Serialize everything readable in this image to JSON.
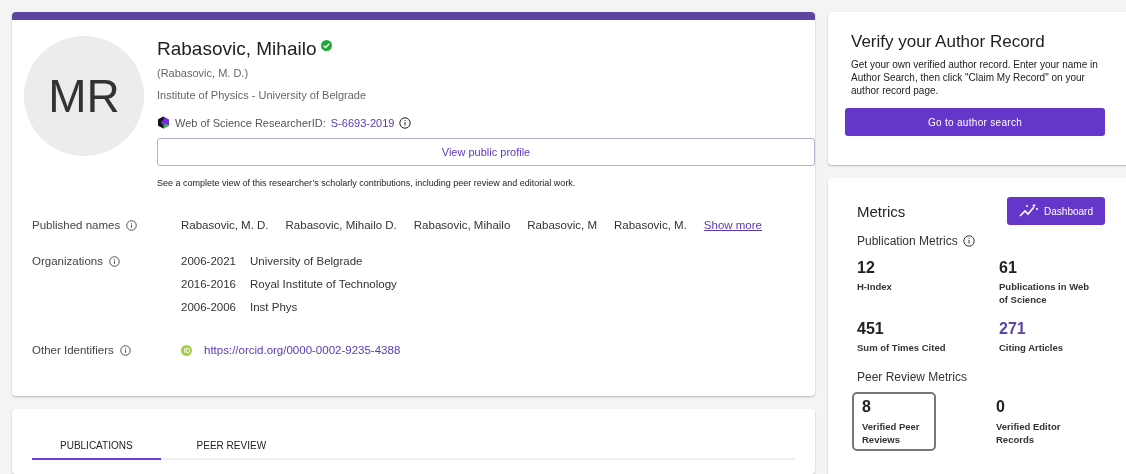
{
  "profile": {
    "initials": "MR",
    "name": "Rabasovic, Mihailo",
    "verified": true,
    "short_name": "(Rabasovic, M. D.)",
    "institution": "Institute of Physics - University of Belgrade",
    "researcher_id_label": "Web of Science ResearcherID:",
    "researcher_id": "S-6693-2019",
    "view_button": "View public profile",
    "view_note": "See a complete view of this researcher’s scholarly contributions, including peer review and editorial work."
  },
  "published_names": {
    "label": "Published names",
    "names": [
      "Rabasovic, M. D.",
      "Rabasovic, Mihailo D.",
      "Rabasovic, Mihailo",
      "Rabasovic, M",
      "Rabasovic, M."
    ],
    "more": "Show more"
  },
  "organizations": {
    "label": "Organizations",
    "items": [
      {
        "years": "2006-2021",
        "name": "University of Belgrade"
      },
      {
        "years": "2016-2016",
        "name": "Royal Institute of Technology"
      },
      {
        "years": "2006-2006",
        "name": "Inst Phys"
      }
    ]
  },
  "other_identifiers": {
    "label": "Other Identifiers",
    "orcid": "https://orcid.org/0000-0002-9235-4388"
  },
  "tabs": [
    {
      "label": "PUBLICATIONS",
      "selected": true
    },
    {
      "label": "PEER REVIEW",
      "selected": false
    }
  ],
  "verify": {
    "title": "Verify your Author Record",
    "text": "Get your own verified author record. Enter your name in Author Search, then click \"Claim My Record\" on your author record page.",
    "button": "Go to author search"
  },
  "metrics": {
    "title": "Metrics",
    "dashboard": "Dashboard",
    "publication_title": "Publication Metrics",
    "publication": [
      {
        "value": "12",
        "label": "H-Index",
        "linked": false
      },
      {
        "value": "61",
        "label": "Publications in Web of Science",
        "linked": false
      },
      {
        "value": "451",
        "label": "Sum of Times Cited",
        "linked": false
      },
      {
        "value": "271",
        "label": "Citing Articles",
        "linked": true
      }
    ],
    "peer_title": "Peer Review Metrics",
    "peer": [
      {
        "value": "8",
        "label": "Verified Peer Reviews",
        "selected": true
      },
      {
        "value": "0",
        "label": "Verified Editor Records",
        "selected": false
      }
    ]
  }
}
